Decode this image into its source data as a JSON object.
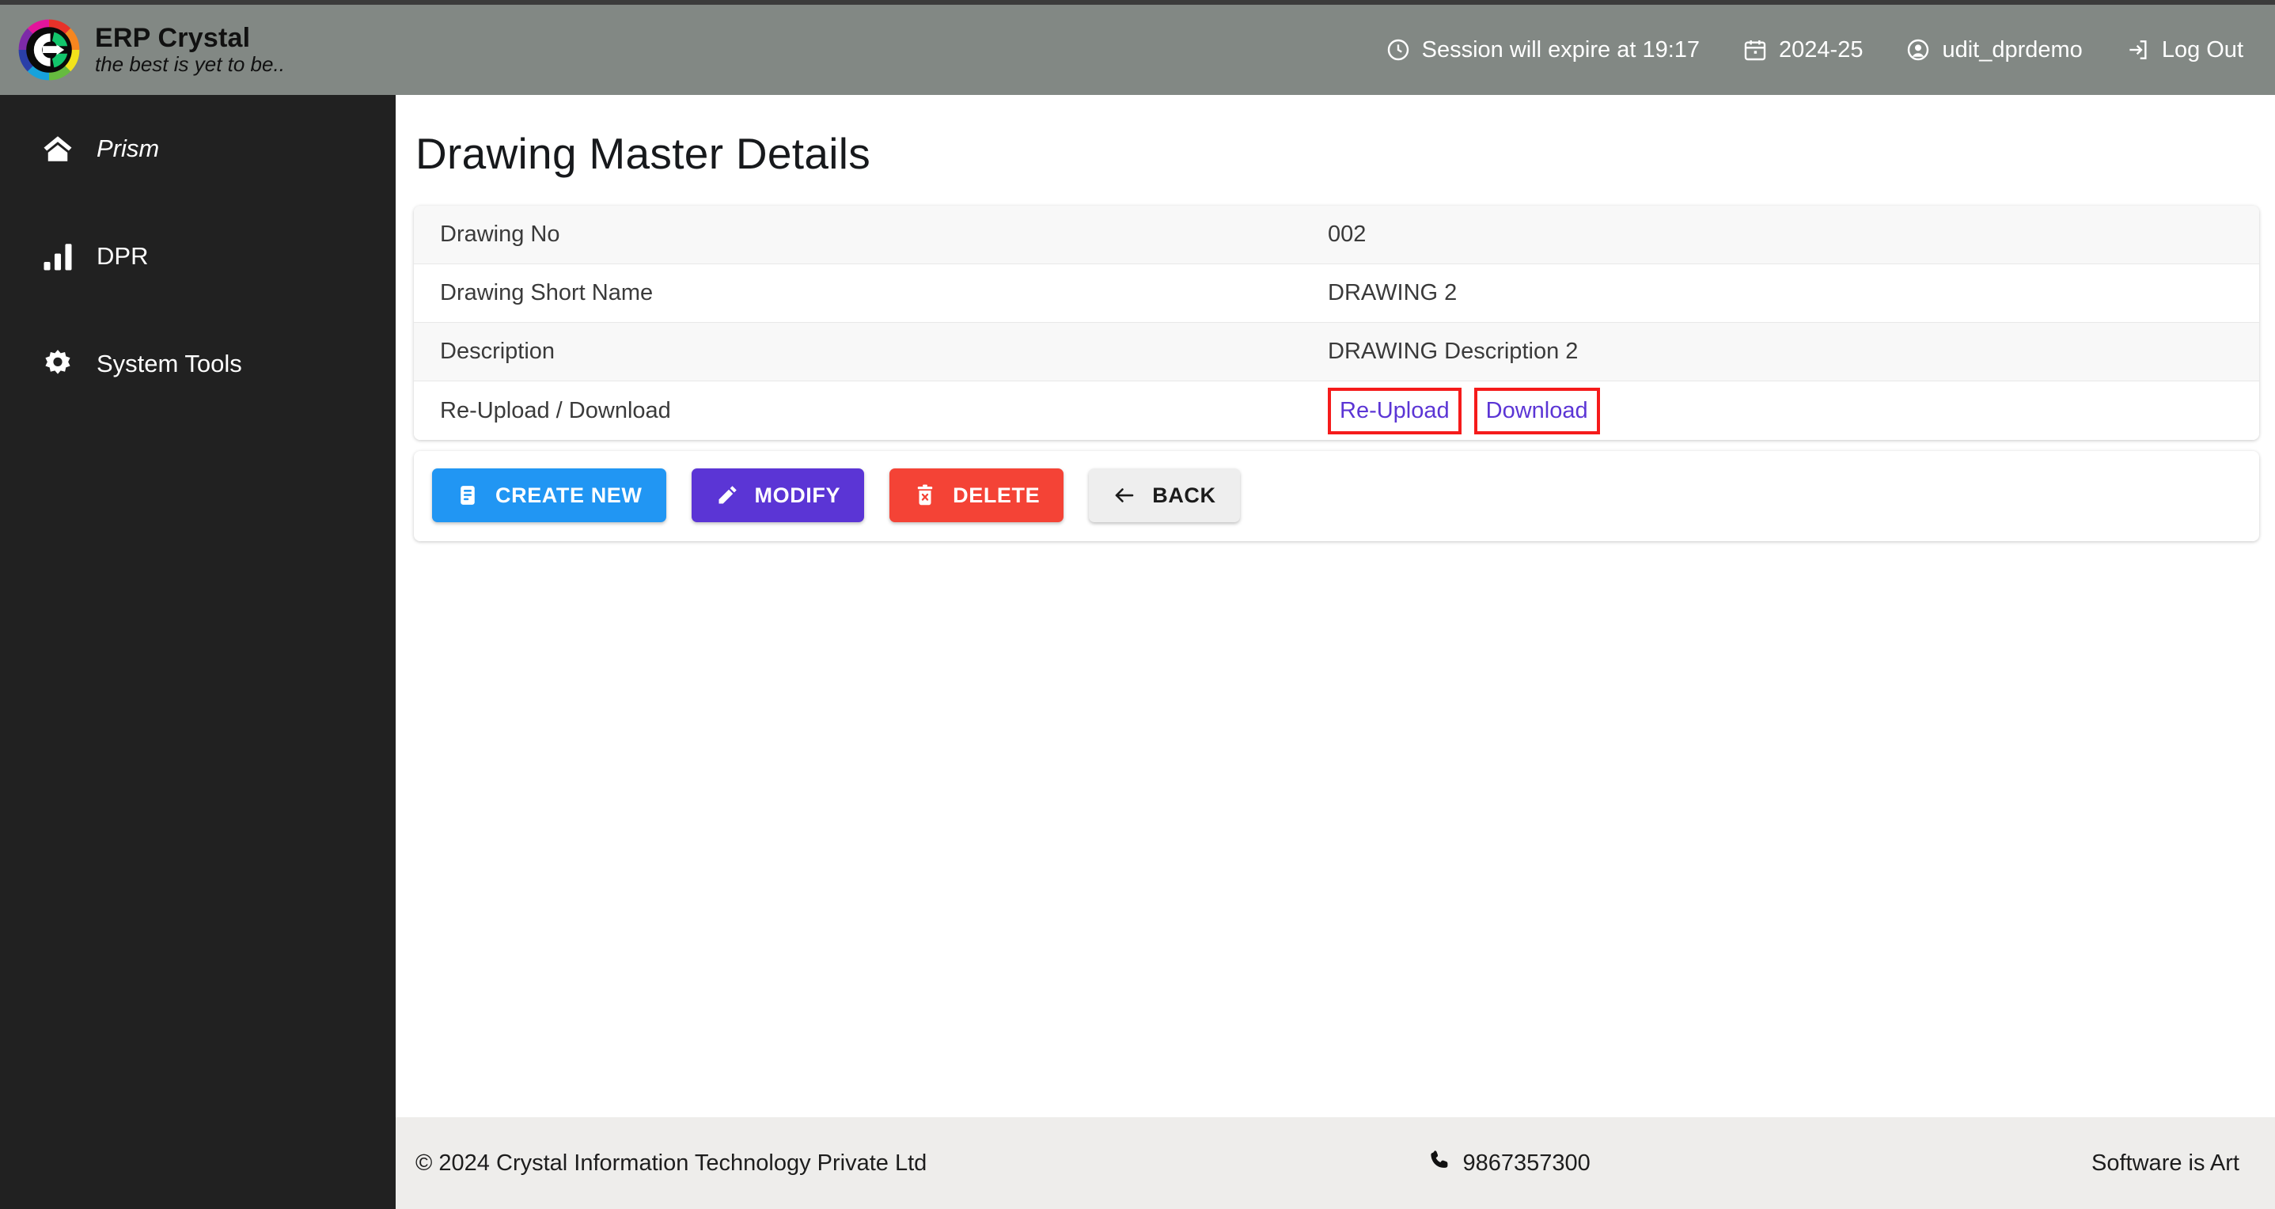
{
  "brand": {
    "title": "ERP Crystal",
    "tagline": "the best is yet to be..",
    "logo_icon": "erp-crystal-logo"
  },
  "header": {
    "background": "#828884",
    "session": {
      "icon": "clock-icon",
      "label": "Session will expire at 19:17"
    },
    "fiscal_year": {
      "icon": "calendar-icon",
      "label": "2024-25"
    },
    "user": {
      "icon": "user-circle-icon",
      "label": "udit_dprdemo"
    },
    "logout": {
      "icon": "logout-icon",
      "label": "Log Out"
    }
  },
  "sidebar": {
    "background": "#212121",
    "items": [
      {
        "label": "Prism",
        "icon": "home-icon",
        "italic": true
      },
      {
        "label": "DPR",
        "icon": "bar-chart-icon",
        "italic": false
      },
      {
        "label": "System Tools",
        "icon": "gear-icon",
        "italic": false
      }
    ]
  },
  "main": {
    "page_title": "Drawing Master Details",
    "details": [
      {
        "label": "Drawing No",
        "value": "002"
      },
      {
        "label": "Drawing Short Name",
        "value": "DRAWING 2"
      },
      {
        "label": "Description",
        "value": "DRAWING Description 2"
      }
    ],
    "upload_row": {
      "label": "Re-Upload / Download",
      "reupload_link": "Re-Upload",
      "download_link": "Download",
      "link_color": "#5b35d5",
      "highlight_color": "#f51b1b"
    },
    "actions": [
      {
        "label": "CREATE NEW",
        "icon": "document-list-icon",
        "color": "#2196f3"
      },
      {
        "label": "MODIFY",
        "icon": "pencil-icon",
        "color": "#5b35d5"
      },
      {
        "label": "DELETE",
        "icon": "trash-x-icon",
        "color": "#f44336"
      },
      {
        "label": "BACK",
        "icon": "arrow-left-icon",
        "color": "#eeeeee"
      }
    ]
  },
  "footer": {
    "copyright": "© 2024 Crystal Information Technology Private Ltd",
    "phone_icon": "phone-icon",
    "phone": "9867357300",
    "tagline": "Software is Art"
  }
}
